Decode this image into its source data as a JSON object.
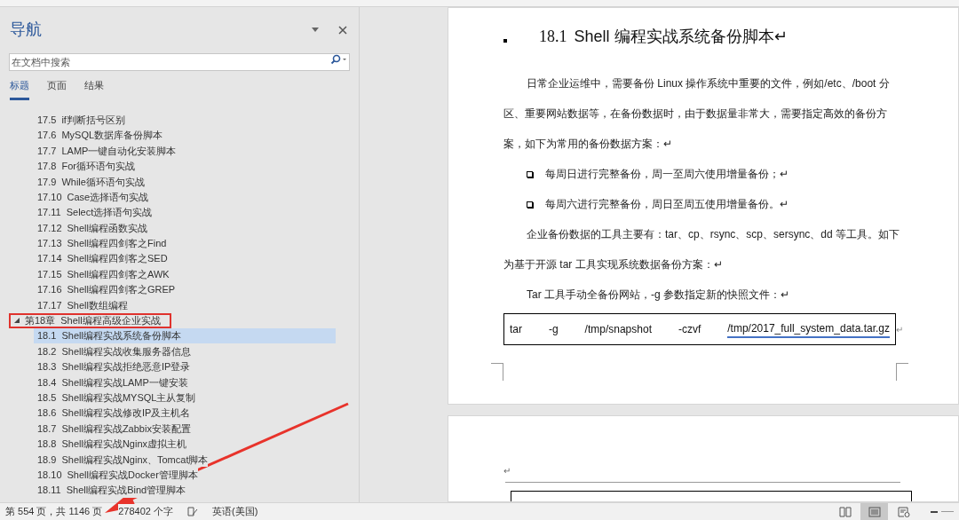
{
  "nav_pane": {
    "title": "导航",
    "search": {
      "placeholder": "在文档中搜索"
    },
    "tabs": [
      {
        "label": "标题",
        "selected": true
      },
      {
        "label": "页面",
        "selected": false
      },
      {
        "label": "结果",
        "selected": false
      }
    ],
    "outline": [
      {
        "number": "17.5",
        "text": "if判断括号区别",
        "selected": false,
        "highlighted": false
      },
      {
        "number": "17.6",
        "text": "MySQL数据库备份脚本",
        "selected": false,
        "highlighted": false
      },
      {
        "number": "17.7",
        "text": "LAMP一键自动化安装脚本",
        "selected": false,
        "highlighted": false
      },
      {
        "number": "17.8",
        "text": "For循环语句实战",
        "selected": false,
        "highlighted": false
      },
      {
        "number": "17.9",
        "text": "While循环语句实战",
        "selected": false,
        "highlighted": false
      },
      {
        "number": "17.10",
        "text": "Case选择语句实战",
        "selected": false,
        "highlighted": false
      },
      {
        "number": "17.11",
        "text": "Select选择语句实战",
        "selected": false,
        "highlighted": false
      },
      {
        "number": "17.12",
        "text": "Shell编程函数实战",
        "selected": false,
        "highlighted": false
      },
      {
        "number": "17.13",
        "text": "Shell编程四剑客之Find",
        "selected": false,
        "highlighted": false
      },
      {
        "number": "17.14",
        "text": "Shell编程四剑客之SED",
        "selected": false,
        "highlighted": false
      },
      {
        "number": "17.15",
        "text": "Shell编程四剑客之AWK",
        "selected": false,
        "highlighted": false
      },
      {
        "number": "17.16",
        "text": "Shell编程四剑客之GREP",
        "selected": false,
        "highlighted": false
      },
      {
        "number": "17.17",
        "text": "Shell数组编程",
        "selected": false,
        "highlighted": false
      },
      {
        "number": "第18章",
        "text": "Shell编程高级企业实战",
        "selected": false,
        "highlighted": true,
        "expanded": true,
        "children": [
          {
            "number": "18.1",
            "text": "Shell编程实战系统备份脚本",
            "selected": true,
            "highlighted": false
          },
          {
            "number": "18.2",
            "text": "Shell编程实战收集服务器信息",
            "selected": false,
            "highlighted": false
          },
          {
            "number": "18.3",
            "text": "Shell编程实战拒绝恶意IP登录",
            "selected": false,
            "highlighted": false
          },
          {
            "number": "18.4",
            "text": "Shell编程实战LAMP一键安装",
            "selected": false,
            "highlighted": false
          },
          {
            "number": "18.5",
            "text": "Shell编程实战MYSQL主从复制",
            "selected": false,
            "highlighted": false
          },
          {
            "number": "18.6",
            "text": "Shell编程实战修改IP及主机名",
            "selected": false,
            "highlighted": false
          },
          {
            "number": "18.7",
            "text": "Shell编程实战Zabbix安装配置",
            "selected": false,
            "highlighted": false
          },
          {
            "number": "18.8",
            "text": "Shell编程实战Nginx虚拟主机",
            "selected": false,
            "highlighted": false
          },
          {
            "number": "18.9",
            "text": "Shell编程实战Nginx、Tomcat脚本",
            "selected": false,
            "highlighted": false
          },
          {
            "number": "18.10",
            "text": "Shell编程实战Docker管理脚本",
            "selected": false,
            "highlighted": false
          },
          {
            "number": "18.11",
            "text": "Shell编程实战Bind管理脚本",
            "selected": false,
            "highlighted": false
          }
        ]
      }
    ]
  },
  "document": {
    "heading_number": "18.1",
    "heading": "Shell 编程实战系统备份脚本↵",
    "blocks": [
      {
        "kind": "paragraph",
        "text": "日常企业运维中，需要备份 Linux 操作系统中重要的文件，例如/etc、/boot 分区、重要网站数据等，在备份数据时，由于数据量非常大，需要指定高效的备份方案，如下为常用的备份数据方案：↵"
      },
      {
        "kind": "bullet",
        "text": "每周日进行完整备份，周一至周六使用增量备份；↵"
      },
      {
        "kind": "bullet",
        "text": "每周六进行完整备份，周日至周五使用增量备份。↵"
      },
      {
        "kind": "paragraph",
        "text": "企业备份数据的工具主要有：tar、cp、rsync、scp、sersync、dd 等工具。如下为基于开源 tar 工具实现系统数据备份方案：↵"
      },
      {
        "kind": "paragraph",
        "text": "Tar 工具手动全备份网站，-g 参数指定新的快照文件：↵"
      },
      {
        "kind": "code",
        "tokens": [
          "tar",
          "-g",
          "/tmp/snapshot",
          "-czvf",
          "/tmp/2017_full_system_data.tar.gz"
        ],
        "mark": "↵"
      }
    ],
    "next_page_mark": "↵"
  },
  "status_bar": {
    "page": "第 554 页，共 1146 页",
    "words": "278402 个字",
    "language": "英语(美国)",
    "views": [
      {
        "kind": "read",
        "selected": false
      },
      {
        "kind": "print",
        "selected": true
      },
      {
        "kind": "web",
        "selected": false
      }
    ]
  }
}
